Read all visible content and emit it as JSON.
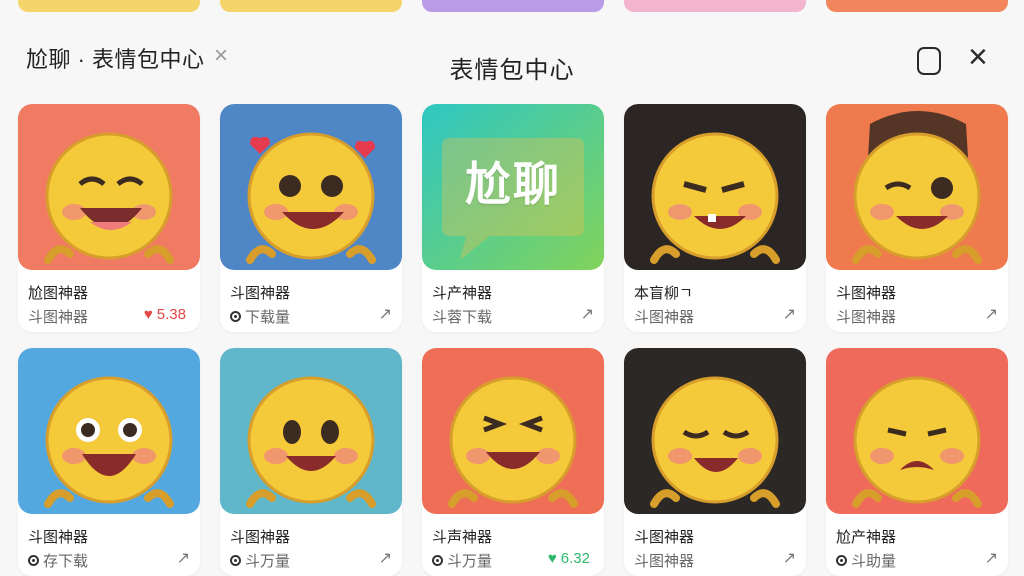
{
  "header": {
    "brand_title": "尬聊 · 表情包中心",
    "brand_close": "×",
    "center_title": "表情包中心",
    "window_close": "×"
  },
  "cards": [
    {
      "title": "尬图神器",
      "meta": "斗图神器",
      "meta_has_dot": false,
      "like": "5.38",
      "like_color": "#e24848",
      "thumb_bg": "#f07a62",
      "face": "laugh",
      "has_logo": false
    },
    {
      "title": "斗图神器",
      "meta": "下载量",
      "meta_has_dot": true,
      "like": "",
      "like_color": "",
      "thumb_bg": "#4f86c6",
      "face": "hearts",
      "has_logo": false
    },
    {
      "title": "斗产神器",
      "meta": "斗蓉下载",
      "meta_has_dot": false,
      "like": "",
      "like_color": "",
      "thumb_bg": "#3fc6b6",
      "face": "",
      "has_logo": true,
      "logo_text": "尬聊"
    },
    {
      "title": "本盲柳ㄱ",
      "meta": "斗图神器",
      "meta_has_dot": false,
      "like": "",
      "like_color": "",
      "thumb_bg": "#2b2623",
      "face": "smirk",
      "has_logo": false
    },
    {
      "title": "斗图神器",
      "meta": "斗图神器",
      "meta_has_dot": false,
      "like": "",
      "like_color": "",
      "thumb_bg": "#ee7a4d",
      "face": "wink",
      "has_logo": false
    },
    {
      "title": "斗图神器",
      "meta": "存下载",
      "meta_has_dot": true,
      "like": "",
      "like_color": "",
      "thumb_bg": "#54a8e0",
      "face": "shock",
      "has_logo": false
    },
    {
      "title": "斗图神器",
      "meta": "斗万量",
      "meta_has_dot": true,
      "like": "",
      "like_color": "",
      "thumb_bg": "#5fb7c9",
      "face": "smile",
      "has_logo": false
    },
    {
      "title": "斗声神器",
      "meta": "斗万量",
      "meta_has_dot": true,
      "like": "6.32",
      "like_color": "#2fb86a",
      "thumb_bg": "#ef6f56",
      "face": "grin",
      "has_logo": false
    },
    {
      "title": "斗图神器",
      "meta": "斗图神器",
      "meta_has_dot": false,
      "like": "",
      "like_color": "",
      "thumb_bg": "#2c2825",
      "face": "squint",
      "has_logo": false
    },
    {
      "title": "尬产神器",
      "meta": "斗助量",
      "meta_has_dot": true,
      "like": "",
      "like_color": "",
      "thumb_bg": "#ef6a5a",
      "face": "cry",
      "has_logo": false
    }
  ],
  "icons": {
    "share": "share-arrow-icon",
    "heart": "heart-icon",
    "view": "view-icon"
  }
}
